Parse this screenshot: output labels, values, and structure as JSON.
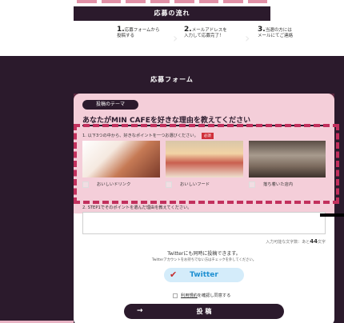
{
  "header": {
    "title": "応募の流れ"
  },
  "steps": [
    {
      "num": "1.",
      "line1": "応募フォームから",
      "line2": "投稿する"
    },
    {
      "num": "2.",
      "line1": "メールアドレスを",
      "line2": "入力して応募完了！"
    },
    {
      "num": "3.",
      "line1": "当選の方には",
      "line2": "メールにてご連絡"
    }
  ],
  "form": {
    "title": "応募フォーム",
    "theme_label": "投稿のテーマ",
    "theme_question": "あなたがMIN CAFEを好きな理由を教えてください",
    "instruction": "1. 以下3つの中から、好きなポイントを一つお選びください。",
    "required": "必須",
    "choices": [
      "おいしいドリンク",
      "おいしいフード",
      "落ち着いた店内"
    ],
    "q2": "2. STEP1でそのポイントを選んだ理由を教えてください。",
    "counter_prefix": "入力可能な文字数：あと",
    "counter_value": "44",
    "counter_suffix": "文字",
    "twitter_note": "Twitterにも同時に投稿できます。",
    "twitter_sub": "Twitterアカウントをお持ちでない方はチェックを外してください。",
    "twitter_button": "Twitter",
    "terms_link": "利用規約",
    "terms_text": "を確認し同意する",
    "submit": "投 稿",
    "submit_arrow": "→"
  },
  "colors": {
    "accent": "#c2305d",
    "dark": "#2b1a2c",
    "twitter": "#1d8fd1"
  }
}
